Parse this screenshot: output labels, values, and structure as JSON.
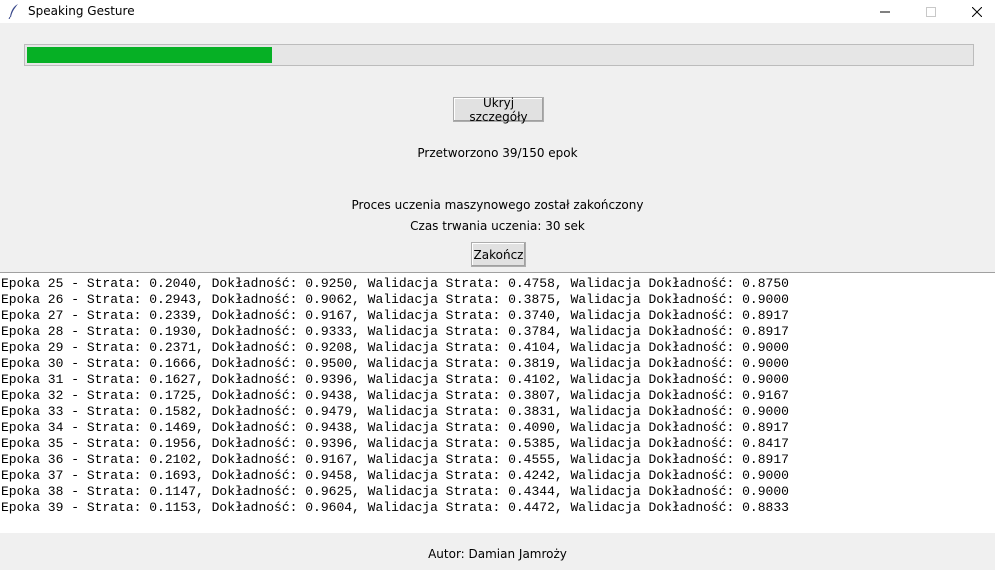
{
  "window": {
    "title": "Speaking Gesture",
    "icon": "feather-icon",
    "controls": [
      "minimize-icon",
      "maximize-icon",
      "close-icon"
    ]
  },
  "progress": {
    "current": 39,
    "total": 150,
    "fraction": 0.26,
    "fill_color": "#06b025"
  },
  "buttons": {
    "toggle_details": "Ukryj szczegóły",
    "finish": "Zakończ"
  },
  "status": {
    "epochs_processed": "Przetworzono 39/150 epok",
    "training_done": "Proces uczenia maszynowego został zakończony",
    "duration": "Czas trwania uczenia: 30 sek"
  },
  "log": [
    "Epoka 25 - Strata: 0.2040, Dokładność: 0.9250, Walidacja Strata: 0.4758, Walidacja Dokładność: 0.8750",
    "Epoka 26 - Strata: 0.2943, Dokładność: 0.9062, Walidacja Strata: 0.3875, Walidacja Dokładność: 0.9000",
    "Epoka 27 - Strata: 0.2339, Dokładność: 0.9167, Walidacja Strata: 0.3740, Walidacja Dokładność: 0.8917",
    "Epoka 28 - Strata: 0.1930, Dokładność: 0.9333, Walidacja Strata: 0.3784, Walidacja Dokładność: 0.8917",
    "Epoka 29 - Strata: 0.2371, Dokładność: 0.9208, Walidacja Strata: 0.4104, Walidacja Dokładność: 0.9000",
    "Epoka 30 - Strata: 0.1666, Dokładność: 0.9500, Walidacja Strata: 0.3819, Walidacja Dokładność: 0.9000",
    "Epoka 31 - Strata: 0.1627, Dokładność: 0.9396, Walidacja Strata: 0.4102, Walidacja Dokładność: 0.9000",
    "Epoka 32 - Strata: 0.1725, Dokładność: 0.9438, Walidacja Strata: 0.3807, Walidacja Dokładność: 0.9167",
    "Epoka 33 - Strata: 0.1582, Dokładność: 0.9479, Walidacja Strata: 0.3831, Walidacja Dokładność: 0.9000",
    "Epoka 34 - Strata: 0.1469, Dokładność: 0.9438, Walidacja Strata: 0.4090, Walidacja Dokładność: 0.8917",
    "Epoka 35 - Strata: 0.1956, Dokładność: 0.9396, Walidacja Strata: 0.5385, Walidacja Dokładność: 0.8417",
    "Epoka 36 - Strata: 0.2102, Dokładność: 0.9167, Walidacja Strata: 0.4555, Walidacja Dokładność: 0.8917",
    "Epoka 37 - Strata: 0.1693, Dokładność: 0.9458, Walidacja Strata: 0.4242, Walidacja Dokładność: 0.9000",
    "Epoka 38 - Strata: 0.1147, Dokładność: 0.9625, Walidacja Strata: 0.4344, Walidacja Dokładność: 0.9000",
    "Epoka 39 - Strata: 0.1153, Dokładność: 0.9604, Walidacja Strata: 0.4472, Walidacja Dokładność: 0.8833"
  ],
  "footer": {
    "author": "Autor: Damian Jamroży"
  }
}
